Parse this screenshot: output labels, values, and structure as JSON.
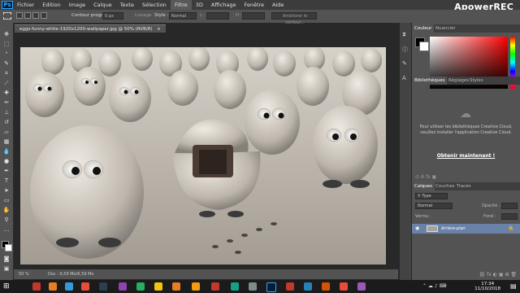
{
  "watermark": "ApowerREC",
  "menu": [
    "Fichier",
    "Edition",
    "Image",
    "Calque",
    "Texte",
    "Sélection",
    "Filtre",
    "3D",
    "Affichage",
    "Fenêtre",
    "Aide"
  ],
  "options": {
    "contour_label": "Contour progr. :",
    "contour_value": "0 px",
    "lissage": "Lissage",
    "style_label": "Style :",
    "style_value": "Normal",
    "width_label": "L :",
    "height_label": "H :",
    "refine_button": "Améliorer le contour..."
  },
  "doc_tab": "eggs-funny-white-1920x1200-wallpaper.jpg @ 50% (RVB/8)",
  "status": {
    "zoom": "50 %",
    "doc": "Doc : 6,59 Mo/6,59 Mo"
  },
  "panels": {
    "color_tabs": [
      "Couleur",
      "Nuancier"
    ],
    "lib_tabs": [
      "Bibliothèques",
      "Réglages",
      "Styles"
    ],
    "lib_message": "Pour utiliser les bibliothèques Creative Cloud, veuillez installer l'application Creative Cloud.",
    "lib_cta": "Obtenir maintenant !",
    "layers_tabs": [
      "Calques",
      "Couches",
      "Tracés"
    ],
    "filter_kind": "Type",
    "blend_mode": "Normal",
    "opacity_label": "Opacité :",
    "lock_label": "Verrou :",
    "fill_label": "Fond :",
    "layer_name": "Arrière-plan"
  },
  "clock": {
    "time": "17:34",
    "date": "11/10/2018"
  },
  "colors": {
    "accent": "#31a8ff",
    "layer_selected": "#6a82a8"
  }
}
